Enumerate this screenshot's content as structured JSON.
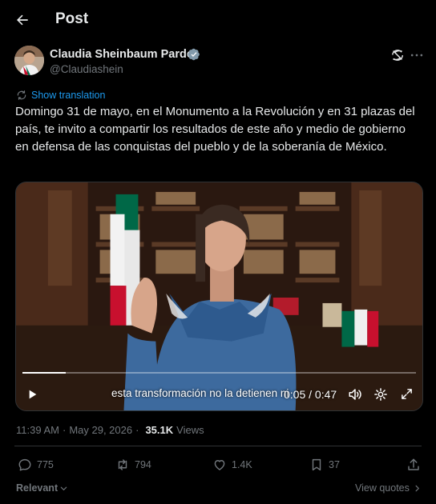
{
  "header": {
    "title": "Post",
    "back_icon": "arrow-left-icon"
  },
  "author": {
    "name": "Claudia Sheinbaum Pardo",
    "handle": "@Claudiashein",
    "verified_icon": "verified-badge-icon"
  },
  "translate": {
    "label": "Show translation",
    "icon": "translate-icon"
  },
  "post": {
    "text": "Domingo 31 de mayo, en el Monumento a la Revolución y en 31 plazas del país, te invito a compartir los resultados de este año y medio de gobierno en defensa de las conquistas del pueblo y de la soberanía de México."
  },
  "video": {
    "caption": "esta transformación no la detienen ni",
    "time": "0:05 / 0:47",
    "progress": 0.11
  },
  "meta": {
    "time": "11:39 AM",
    "date": "May 29, 2026",
    "separator": "·",
    "views_count": "35.1K",
    "views_label": "Views"
  },
  "actions": {
    "replies": "775",
    "reposts": "794",
    "likes": "1.4K",
    "bookmarks": "37"
  },
  "footer": {
    "sort_label": "Relevant",
    "view_quotes": "View quotes"
  },
  "colors": {
    "accent": "#1d9bf0",
    "text": "#e7e9ea",
    "muted": "#71767b",
    "background": "#000000",
    "border": "#2f3336"
  }
}
